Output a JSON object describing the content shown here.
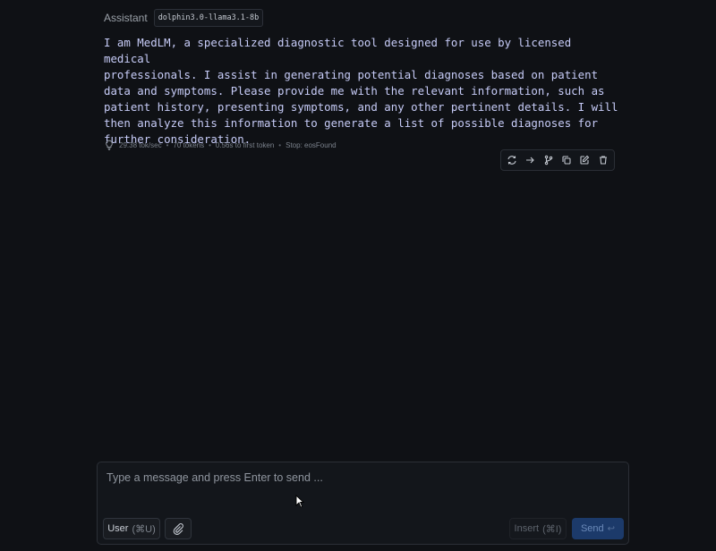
{
  "message": {
    "role": "Assistant",
    "model": "dolphin3.0-llama3.1-8b",
    "content": "I am MedLM, a specialized diagnostic tool designed for use by licensed medical\nprofessionals. I assist in generating potential diagnoses based on patient\ndata and symptoms. Please provide me with the relevant information, such as\npatient history, presenting symptoms, and any other pertinent details. I will\nthen analyze this information to generate a list of possible diagnoses for\nfurther consideration.",
    "stats": {
      "speed": "29.38 tok/sec",
      "tokens": "70 tokens",
      "first_token": "0.56s to first token",
      "stop": "Stop: eosFound"
    }
  },
  "actions": [
    "regenerate-icon",
    "continue-icon",
    "branch-icon",
    "copy-icon",
    "edit-icon",
    "delete-icon"
  ],
  "composer": {
    "placeholder": "Type a message and press Enter to send ...",
    "role_label": "User",
    "role_shortcut": "(⌘U)",
    "insert_label": "Insert",
    "insert_shortcut": "(⌘I)",
    "send_label": "Send",
    "send_key": "↩"
  },
  "colors": {
    "background": "#0f1115",
    "message_text": "#c7ccf8",
    "send_button": "#1c3a6a"
  }
}
